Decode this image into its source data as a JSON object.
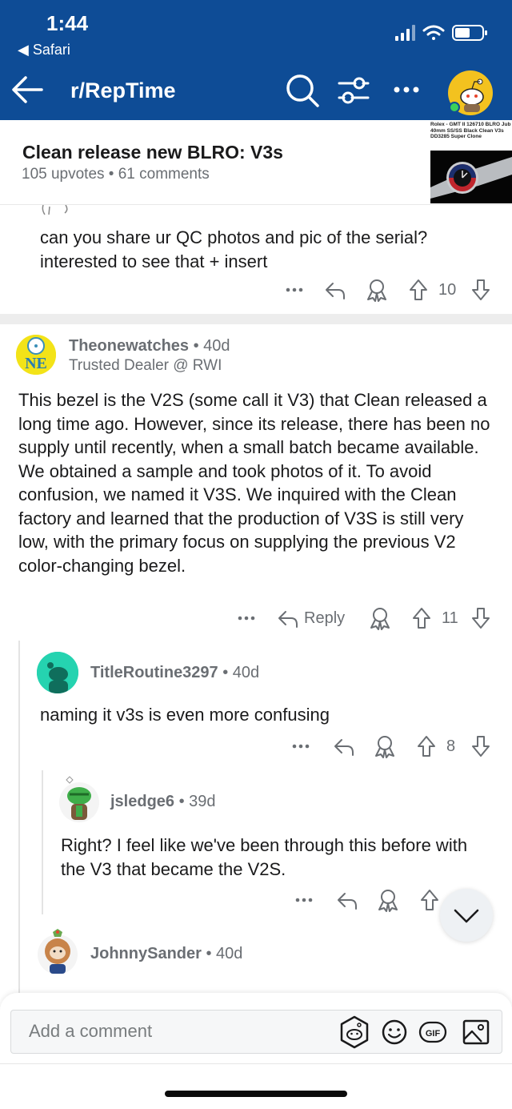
{
  "status_bar": {
    "time": "1:44",
    "back_app": "◀ Safari"
  },
  "nav": {
    "title": "r/RepTime"
  },
  "post": {
    "title": "Clean release new BLRO: V3s",
    "meta": "105 upvotes • 61 comments",
    "thumbnail_text": "Rolex - GMT II 126710 BLRO Jub 40mm SS/SS Black Clean V3s DD3285 Super Clone"
  },
  "comments": [
    {
      "body": "can you share ur QC photos and pic of the serial? interested to see that + insert",
      "votes": "10"
    },
    {
      "author": "Theonewatches",
      "age": " • 40d",
      "flair": "Trusted Dealer @ RWI",
      "avatar_text": "NE",
      "body": "This bezel is the V2S (some call it V3) that Clean released a long time ago. However, since its release, there has been no supply until recently, when a small batch became available. We obtained a sample and took photos of it. To avoid confusion, we named it V3S. We inquired with the Clean factory and learned that the production of V3S is still very low, with the primary focus on supplying the previous V2 color-changing bezel.",
      "reply_label": "Reply",
      "votes": "11"
    },
    {
      "author": "TitleRoutine3297",
      "age": " • 40d",
      "body": "naming it v3s is even more confusing",
      "votes": "8"
    },
    {
      "author": "jsledge6",
      "age": " • 39d",
      "body": "Right? I feel like we've been through this before with the V3 that became the V2S."
    },
    {
      "author": "JohnnySander",
      "age": " • 40d"
    }
  ],
  "composer": {
    "placeholder": "Add a comment",
    "gif_label": "GIF"
  },
  "colors": {
    "header": "#0e4c96",
    "meta_gray": "#6a6e73",
    "avatar_teal": "#25d3b0",
    "avatar_yellow": "#f3c21f"
  }
}
